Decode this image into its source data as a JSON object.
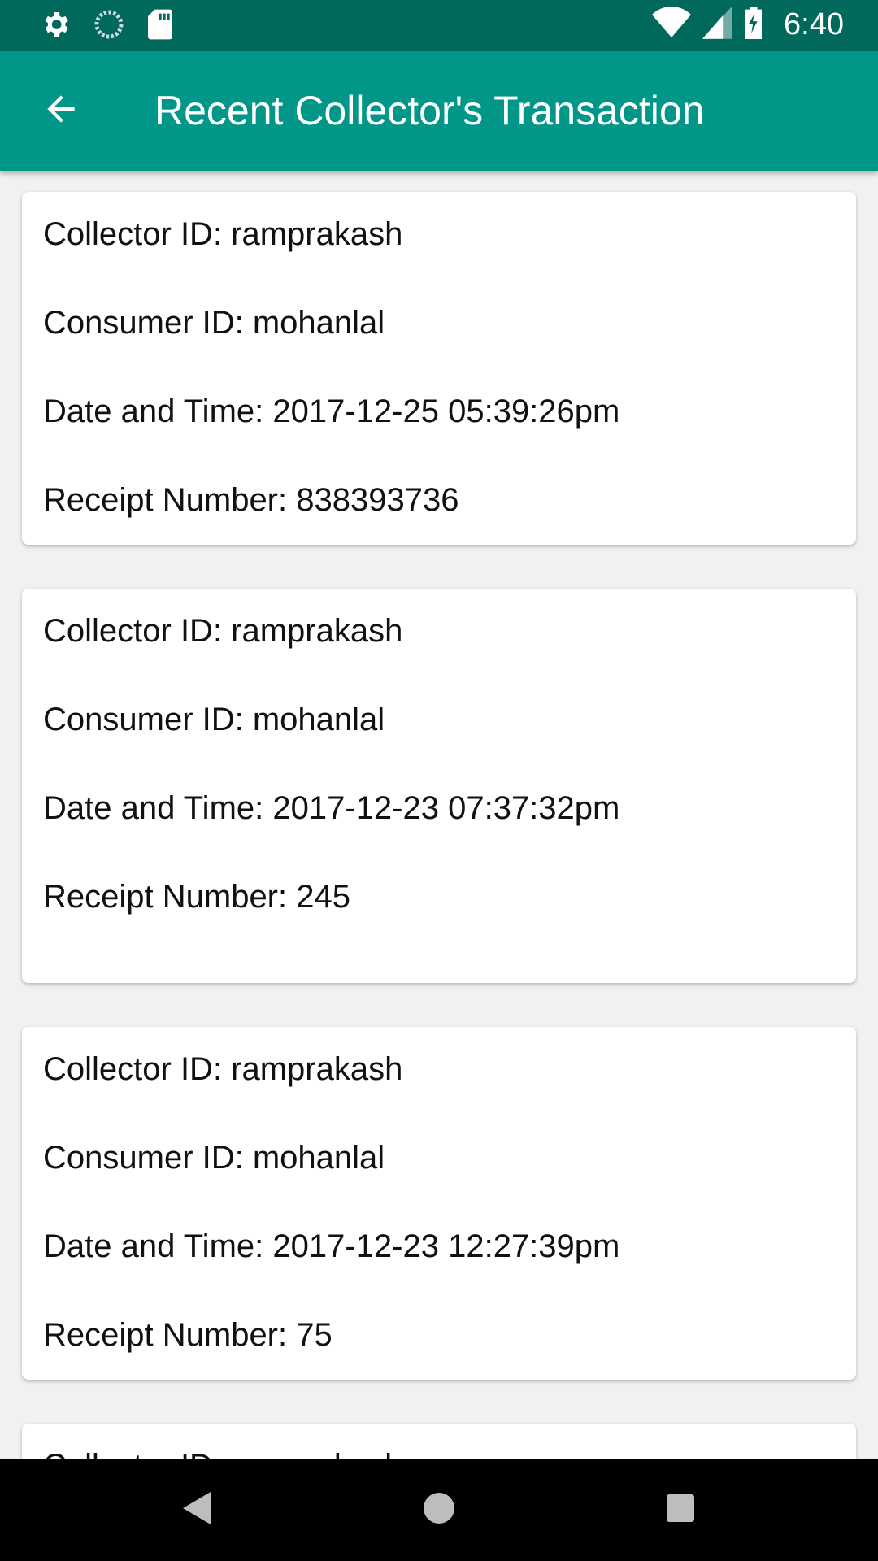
{
  "status_bar": {
    "time": "6:40",
    "icons": [
      "gear-icon",
      "sync-icon",
      "sd-card-icon",
      "wifi-icon",
      "signal-icon",
      "battery-charging-icon"
    ]
  },
  "app_bar": {
    "title": "Recent Collector's Transaction",
    "back_icon": "arrow-back-icon"
  },
  "transactions": [
    {
      "collector": "Collector ID: ramprakash",
      "consumer": "Consumer ID: mohanlal",
      "datetime": "Date and Time: 2017-12-25 05:39:26pm",
      "receipt": "Receipt Number: 838393736"
    },
    {
      "collector": "Collector ID: ramprakash",
      "consumer": "Consumer ID: mohanlal",
      "datetime": "Date and Time: 2017-12-23 07:37:32pm",
      "receipt": "Receipt Number: 245"
    },
    {
      "collector": "Collector ID: ramprakash",
      "consumer": "Consumer ID: mohanlal",
      "datetime": "Date and Time: 2017-12-23 12:27:39pm",
      "receipt": "Receipt Number: 75"
    },
    {
      "collector": "Collector ID: ramprakash"
    }
  ],
  "nav_bar": {
    "icons": [
      "back-triangle-icon",
      "home-circle-icon",
      "recents-square-icon"
    ]
  },
  "colors": {
    "status_bar": "#00695c",
    "app_bar": "#009688",
    "background": "#f1f1f1"
  }
}
